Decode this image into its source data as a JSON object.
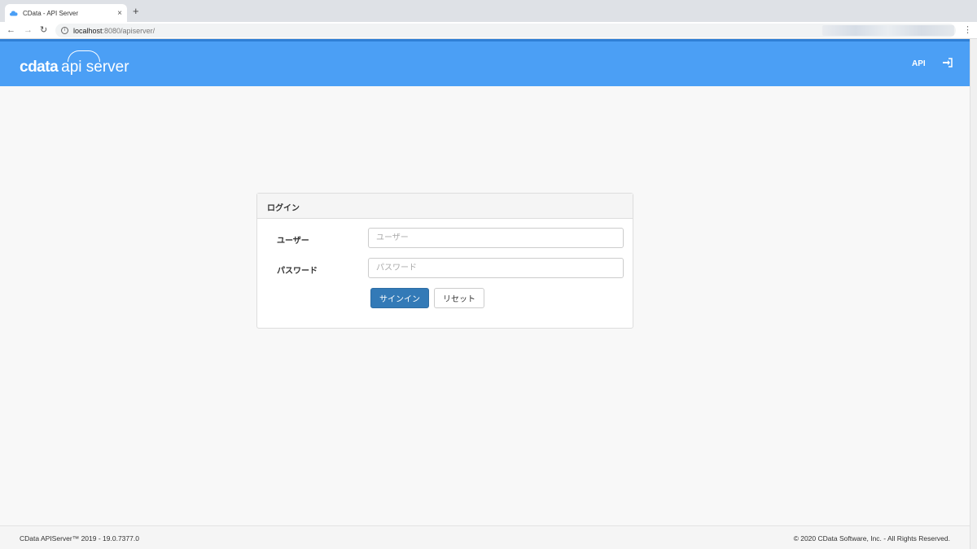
{
  "browser": {
    "tab_title": "CData - API Server",
    "tab_close": "×",
    "new_tab": "+",
    "url_host": "localhost",
    "url_path": ":8080/apiserver/",
    "back": "←",
    "forward": "→",
    "reload": "↻",
    "menu": "⋮"
  },
  "header": {
    "brand": "cdata",
    "product": "api server",
    "nav_api": "API",
    "color": "#4b9ff5"
  },
  "login": {
    "title": "ログイン",
    "user_label": "ユーザー",
    "user_placeholder": "ユーザー",
    "password_label": "パスワード",
    "password_placeholder": "パスワード",
    "signin_button": "サインイン",
    "reset_button": "リセット"
  },
  "footer": {
    "version": "CData APIServer™ 2019 - 19.0.7377.0",
    "copyright": "© 2020 CData Software, Inc. - All Rights Reserved."
  }
}
